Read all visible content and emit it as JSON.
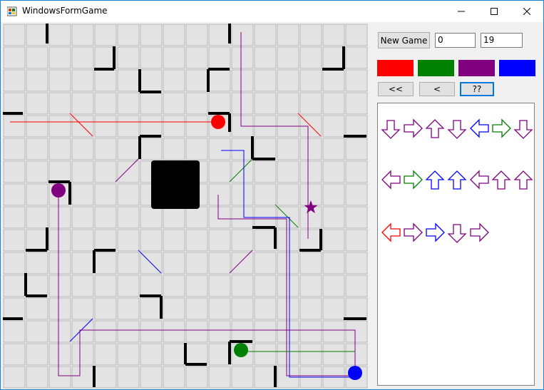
{
  "window": {
    "title": "WindowsFormGame",
    "icon": "winforms-app-icon"
  },
  "controls": {
    "new_game_label": "New Game",
    "score_value": "0",
    "moves_value": "19",
    "color_buttons": [
      "#ff0000",
      "#008000",
      "#800080",
      "#0000ff"
    ],
    "nav_first_label": "<<",
    "nav_prev_label": "<",
    "nav_hint_label": "??"
  },
  "board": {
    "grid_size": 16,
    "robots": [
      {
        "color": "#ff0000",
        "col": 9,
        "row": 4
      },
      {
        "color": "#800080",
        "col": 2,
        "row": 7
      },
      {
        "color": "#008000",
        "col": 10,
        "row": 14
      },
      {
        "color": "#0000ff",
        "col": 15,
        "row": 15
      }
    ],
    "target": {
      "shape": "star",
      "color": "#800080",
      "col": 13,
      "row": 9
    },
    "center_block": {
      "col_start": 7,
      "row_start": 7,
      "span": 2
    }
  },
  "moves_panel": {
    "rows": [
      [
        {
          "dir": "down",
          "color": "#800080"
        },
        {
          "dir": "right",
          "color": "#800080"
        },
        {
          "dir": "up",
          "color": "#800080"
        },
        {
          "dir": "down",
          "color": "#800080"
        },
        {
          "dir": "left",
          "color": "#0000ff"
        },
        {
          "dir": "right",
          "color": "#008000"
        },
        {
          "dir": "down",
          "color": "#800080"
        }
      ],
      [
        {
          "dir": "left",
          "color": "#800080"
        },
        {
          "dir": "right",
          "color": "#008000"
        },
        {
          "dir": "up",
          "color": "#0000ff"
        },
        {
          "dir": "up",
          "color": "#0000ff"
        },
        {
          "dir": "left",
          "color": "#800080"
        },
        {
          "dir": "up",
          "color": "#800080"
        },
        {
          "dir": "up",
          "color": "#800080"
        }
      ],
      [
        {
          "dir": "left",
          "color": "#ff0000"
        },
        {
          "dir": "right",
          "color": "#800080"
        },
        {
          "dir": "right",
          "color": "#0000ff"
        },
        {
          "dir": "down",
          "color": "#800080"
        },
        {
          "dir": "right",
          "color": "#800080"
        }
      ]
    ]
  }
}
